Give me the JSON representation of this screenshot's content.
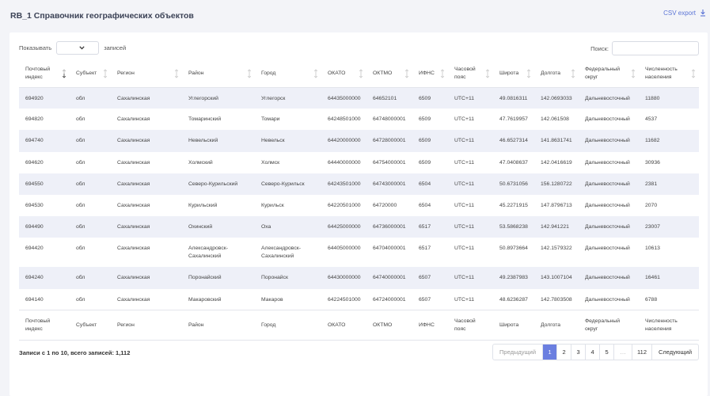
{
  "header": {
    "title": "RB_1 Справочник географических объектов",
    "csv_export": "CSV export"
  },
  "controls": {
    "show_label": "Показывать",
    "show_value": "",
    "entries_label": "записей",
    "search_label": "Поиск:",
    "search_value": ""
  },
  "table": {
    "columns": [
      "Почтовый индекс",
      "Субъект",
      "Регион",
      "Район",
      "Город",
      "ОКАТО",
      "ОКТМО",
      "ИФНС",
      "Часовой пояс",
      "Широта",
      "Долгота",
      "Федеральный округ",
      "Численность населения"
    ],
    "rows": [
      [
        "694920",
        "обл",
        "Сахалинская",
        "Углегорский",
        "Углегорск",
        "64435000000",
        "64652101",
        "6509",
        "UTC+11",
        "49.0816311",
        "142.0693033",
        "Дальневосточный",
        "11880"
      ],
      [
        "694820",
        "обл",
        "Сахалинская",
        "Томаринский",
        "Томари",
        "64248501000",
        "64748000001",
        "6509",
        "UTC+11",
        "47.7619957",
        "142.061508",
        "Дальневосточный",
        "4537"
      ],
      [
        "694740",
        "обл",
        "Сахалинская",
        "Невельский",
        "Невельск",
        "64420000000",
        "64728000001",
        "6509",
        "UTC+11",
        "46.6527314",
        "141.8631741",
        "Дальневосточный",
        "11682"
      ],
      [
        "694620",
        "обл",
        "Сахалинская",
        "Холмский",
        "Холмск",
        "64440000000",
        "64754000001",
        "6509",
        "UTC+11",
        "47.0408637",
        "142.0416619",
        "Дальневосточный",
        "30936"
      ],
      [
        "694550",
        "обл",
        "Сахалинская",
        "Северо-Курильский",
        "Северо-Курильск",
        "64243501000",
        "64743000001",
        "6504",
        "UTC+11",
        "50.6731056",
        "156.1280722",
        "Дальневосточный",
        "2381"
      ],
      [
        "694530",
        "обл",
        "Сахалинская",
        "Курильский",
        "Курильск",
        "64220501000",
        "64720000",
        "6504",
        "UTC+11",
        "45.2271915",
        "147.8796713",
        "Дальневосточный",
        "2070"
      ],
      [
        "694490",
        "обл",
        "Сахалинская",
        "Охинский",
        "Оха",
        "64425000000",
        "64736000001",
        "6517",
        "UTC+11",
        "53.5868238",
        "142.941221",
        "Дальневосточный",
        "23007"
      ],
      [
        "694420",
        "обл",
        "Сахалинская",
        "Александровск-Сахалинский",
        "Александровск-Сахалинский",
        "64405000000",
        "64704000001",
        "6517",
        "UTC+11",
        "50.8973664",
        "142.1579322",
        "Дальневосточный",
        "10613"
      ],
      [
        "694240",
        "обл",
        "Сахалинская",
        "Поронайский",
        "Поронайск",
        "64430000000",
        "64740000001",
        "6507",
        "UTC+11",
        "49.2387983",
        "143.1007104",
        "Дальневосточный",
        "16461"
      ],
      [
        "694140",
        "обл",
        "Сахалинская",
        "Макаровский",
        "Макаров",
        "64224501000",
        "64724000001",
        "6507",
        "UTC+11",
        "48.6236287",
        "142.7803508",
        "Дальневосточный",
        "6788"
      ]
    ]
  },
  "footer": {
    "info": "Записи с 1 по 10, всего записей: 1,112",
    "prev": "Предыдущий",
    "pages": [
      "1",
      "2",
      "3",
      "4",
      "5",
      "…",
      "112"
    ],
    "next": "Следующий",
    "active_page": "1"
  },
  "colors": {
    "accent": "#6b7fe0",
    "link": "#5b74d6",
    "row_stripe": "#eef0f8",
    "background": "#f3f4f8"
  }
}
